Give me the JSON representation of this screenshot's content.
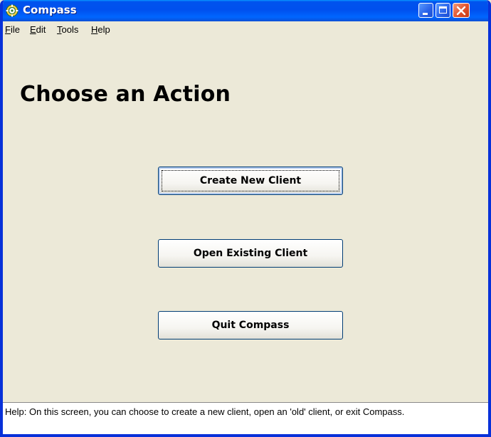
{
  "window": {
    "title": "Compass",
    "icon": "compass-gear-icon",
    "controls": [
      "minimize-icon",
      "maximize-icon",
      "close-icon"
    ]
  },
  "menu": {
    "items": [
      {
        "label": "File",
        "mnemonic": "F"
      },
      {
        "label": "Edit",
        "mnemonic": "E"
      },
      {
        "label": "Tools",
        "mnemonic": "T"
      },
      {
        "label": "Help",
        "mnemonic": "H"
      }
    ]
  },
  "main": {
    "heading": "Choose an Action",
    "buttons": [
      {
        "label": "Create New Client",
        "focused": true
      },
      {
        "label": "Open Existing Client",
        "focused": false
      },
      {
        "label": "Quit Compass",
        "focused": false
      }
    ]
  },
  "help": {
    "text": "Help:  On this screen, you can choose to create a new client, open an 'old' client, or exit Compass."
  },
  "colors": {
    "titlebar": "#0053ee",
    "window_bg": "#ece9d8",
    "close_button": "#e0522d",
    "button_border": "#003c74"
  }
}
